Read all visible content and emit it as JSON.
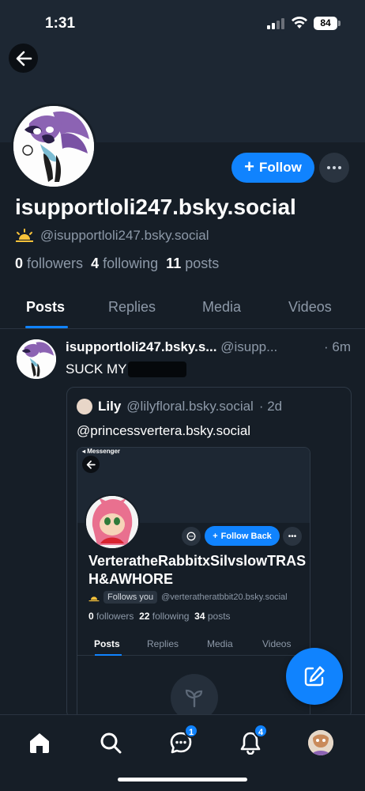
{
  "status_bar": {
    "time": "1:31",
    "battery": "84"
  },
  "profile": {
    "display_name": "isupportloli247.bsky.social",
    "handle": "@isupportloli247.bsky.social",
    "followers_count": "0",
    "followers_label": "followers",
    "following_count": "4",
    "following_label": "following",
    "posts_count": "11",
    "posts_label": "posts",
    "follow_label": "Follow"
  },
  "tabs": [
    "Posts",
    "Replies",
    "Media",
    "Videos"
  ],
  "post": {
    "author": "isupportloli247.bsky.s...",
    "handle": "@isupp...",
    "time": "· 6m",
    "text": "SUCK MY"
  },
  "quote": {
    "author": "Lily",
    "handle": "@lilyfloral.bsky.social",
    "time": "· 2d",
    "text": "@princessvertera.bsky.social"
  },
  "embed": {
    "messenger": "◂ Messenger",
    "follow_back": "Follow Back",
    "name": "VerteratheRabbitxSilvslowTRASH&AWHORE",
    "follows_you": "Follows you",
    "handle": "@verteratheratbbit20.bsky.social",
    "followers_count": "0",
    "followers_label": "followers",
    "following_count": "22",
    "following_label": "following",
    "posts_count": "34",
    "posts_label": "posts",
    "tabs": [
      "Posts",
      "Replies",
      "Media",
      "Videos"
    ]
  },
  "nav": {
    "messages_badge": "1",
    "notifications_badge": "4"
  },
  "colors": {
    "accent": "#1083fe",
    "background": "#161e27",
    "banner": "#1d2733"
  }
}
